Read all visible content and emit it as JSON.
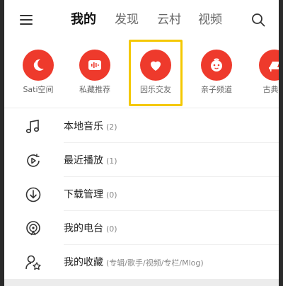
{
  "topbar": {
    "tabs": [
      "我的",
      "发现",
      "云村",
      "视频"
    ],
    "active_tab": "我的"
  },
  "shortcuts": [
    {
      "label": "Sati空间",
      "icon": "moon-icon"
    },
    {
      "label": "私藏推荐",
      "icon": "waveform-icon"
    },
    {
      "label": "因乐交友",
      "icon": "heart-icon",
      "selected": true
    },
    {
      "label": "亲子频道",
      "icon": "kid-face-icon"
    },
    {
      "label": "古典专",
      "icon": "piano-icon"
    }
  ],
  "list": [
    {
      "title": "本地音乐",
      "count": "(2)",
      "icon": "music-note-icon"
    },
    {
      "title": "最近播放",
      "count": "(1)",
      "icon": "recent-play-icon"
    },
    {
      "title": "下载管理",
      "count": "(0)",
      "icon": "download-icon"
    },
    {
      "title": "我的电台",
      "count": "(0)",
      "icon": "radio-icon"
    },
    {
      "title": "我的收藏",
      "count": "(专辑/歌手/视频/专栏/Mlog)",
      "icon": "collection-icon"
    }
  ],
  "colors": {
    "accent": "#ee3a2c",
    "highlight_box": "#f4c800"
  }
}
